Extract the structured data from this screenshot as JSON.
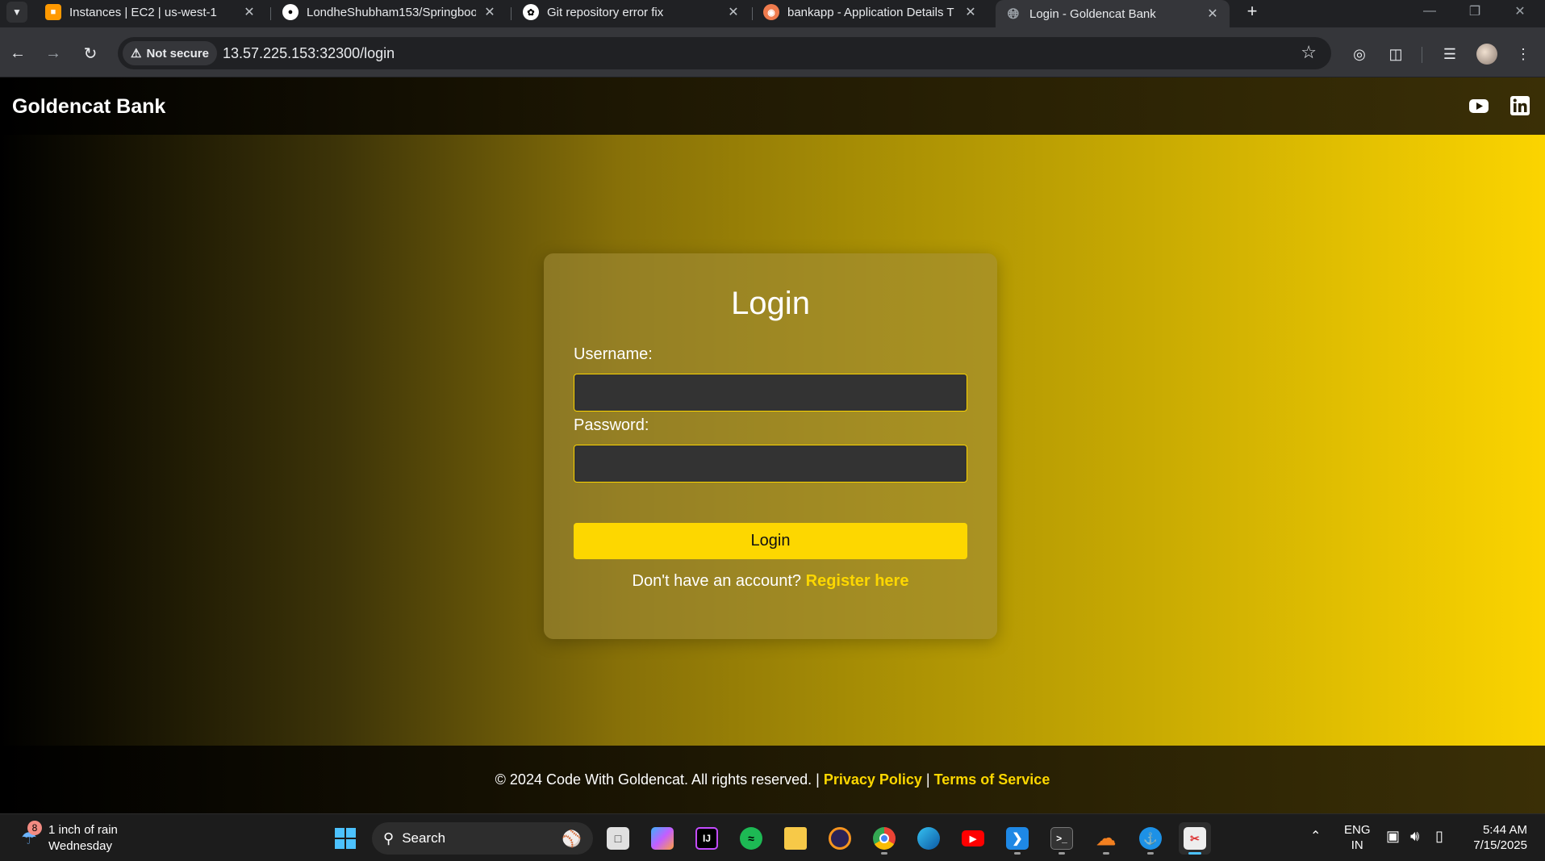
{
  "browser": {
    "tabs": [
      {
        "title": "Instances | EC2 | us-west-1",
        "favicon": "aws-ec2-icon",
        "color": "#ff9900"
      },
      {
        "title": "LondheShubham153/Springboo",
        "favicon": "github-icon",
        "color": "#ffffff"
      },
      {
        "title": "Git repository error fix",
        "favicon": "chatgpt-icon",
        "color": "#ffffff"
      },
      {
        "title": "bankapp - Application Details T",
        "favicon": "argocd-icon",
        "color": "#ef7b4d"
      },
      {
        "title": "Login - Goldencat Bank",
        "favicon": "globe-icon",
        "color": "#9aa0a6",
        "active": true
      }
    ],
    "security_label": "Not secure",
    "url": "13.57.225.153:32300/login"
  },
  "site": {
    "brand": "Goldencat Bank",
    "social": [
      "youtube-icon",
      "linkedin-icon"
    ],
    "login": {
      "title": "Login",
      "username_label": "Username:",
      "username_value": "",
      "password_label": "Password:",
      "password_value": "",
      "button_label": "Login",
      "register_prompt": "Don't have an account?",
      "register_link": "Register here"
    },
    "footer": {
      "copyright": "© 2024 Code With Goldencat. All rights reserved.",
      "separator": "|",
      "privacy": "Privacy Policy",
      "terms": "Terms of Service"
    },
    "colors": {
      "accent": "#fdd700",
      "input_bg": "#333333"
    }
  },
  "taskbar": {
    "weather": {
      "badge": "8",
      "line1": "1 inch of rain",
      "line2": "Wednesday"
    },
    "search_label": "Search",
    "lang_line1": "ENG",
    "lang_line2": "IN",
    "time": "5:44 AM",
    "date": "7/15/2025"
  }
}
